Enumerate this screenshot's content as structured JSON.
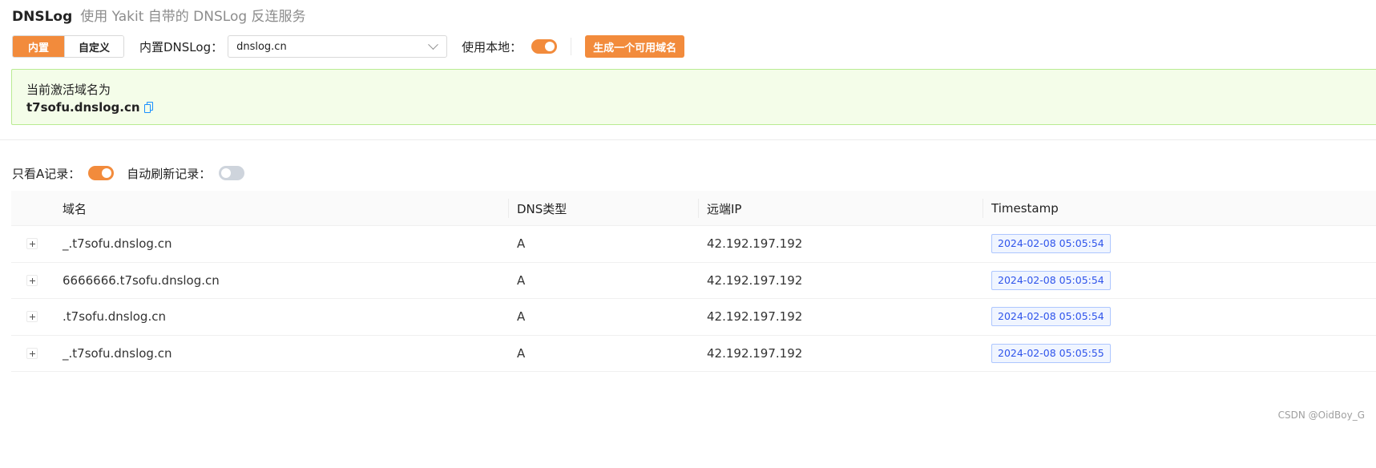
{
  "header": {
    "title": "DNSLog",
    "subtitle": "使用 Yakit 自带的 DNSLog 反连服务"
  },
  "toolbar": {
    "mode_builtin": "内置",
    "mode_custom": "自定义",
    "builtin_dnslog_label": "内置DNSLog：",
    "builtin_dnslog_value": "dnslog.cn",
    "use_local_label": "使用本地：",
    "use_local_enabled": true,
    "generate_button": "生成一个可用域名"
  },
  "active_domain": {
    "label": "当前激活域名为",
    "domain": "t7sofu.dnslog.cn"
  },
  "filters": {
    "only_a_label": "只看A记录：",
    "only_a_enabled": true,
    "auto_refresh_label": "自动刷新记录：",
    "auto_refresh_enabled": false
  },
  "table": {
    "columns": [
      "域名",
      "DNS类型",
      "远端IP",
      "Timestamp"
    ],
    "rows": [
      {
        "domain": "_.t7sofu.dnslog.cn",
        "type": "A",
        "ip": "42.192.197.192",
        "timestamp": "2024-02-08 05:05:54"
      },
      {
        "domain": "6666666.t7sofu.dnslog.cn",
        "type": "A",
        "ip": "42.192.197.192",
        "timestamp": "2024-02-08 05:05:54"
      },
      {
        "domain": ".t7sofu.dnslog.cn",
        "type": "A",
        "ip": "42.192.197.192",
        "timestamp": "2024-02-08 05:05:54"
      },
      {
        "domain": "_.t7sofu.dnslog.cn",
        "type": "A",
        "ip": "42.192.197.192",
        "timestamp": "2024-02-08 05:05:55"
      }
    ]
  },
  "watermark": "CSDN @OidBoy_G",
  "colors": {
    "accent": "#f28b3c",
    "success_bg": "#f4fde9",
    "success_border": "#b9eb92",
    "tag_text": "#2f54eb",
    "copy_icon": "#1890ff"
  }
}
